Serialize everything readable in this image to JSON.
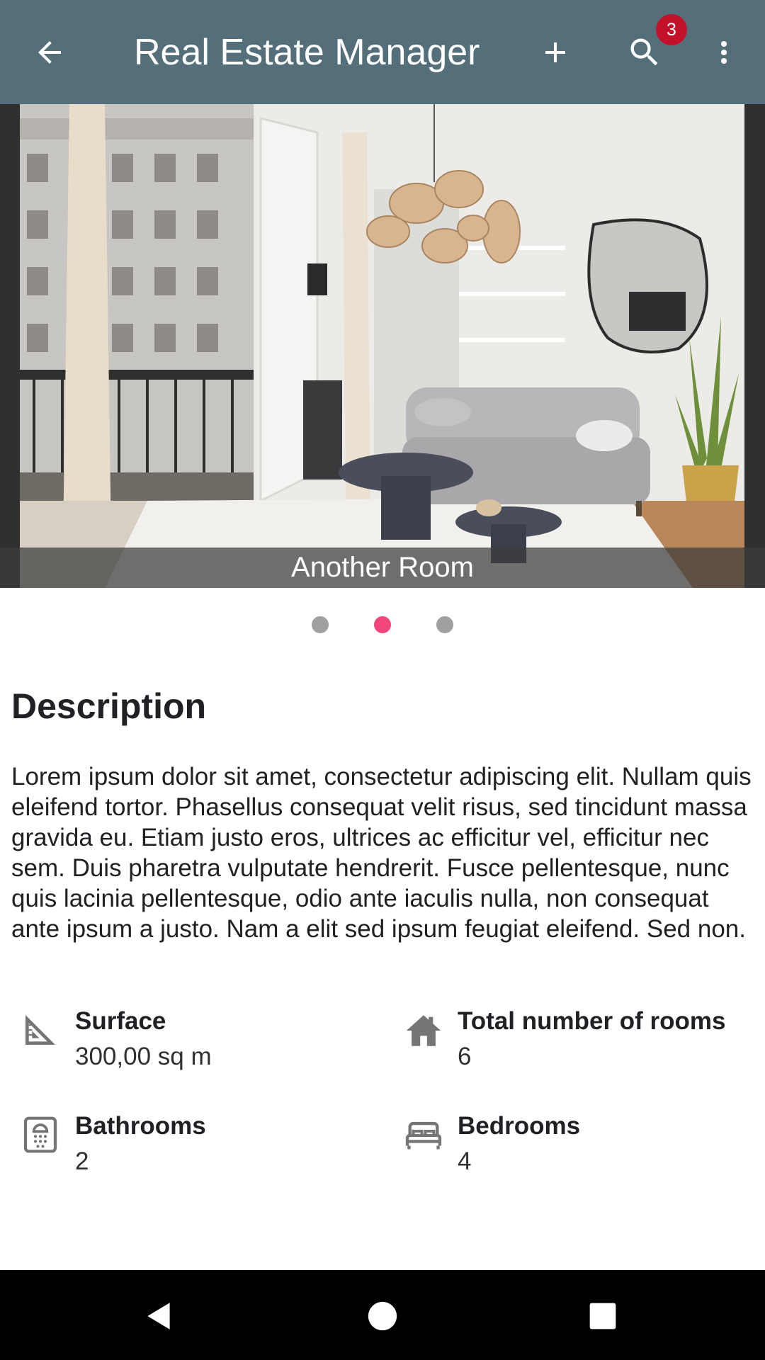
{
  "appbar": {
    "title": "Real Estate Manager",
    "back_icon": "arrow-back-icon",
    "add_icon": "add-icon",
    "search_icon": "search-icon",
    "search_badge": "3",
    "more_icon": "more-vert-icon",
    "background": "#546e7a"
  },
  "carousel": {
    "caption": "Another Room",
    "total_pages": 3,
    "active_page": 2,
    "dot_active_color": "#f0467a",
    "dot_inactive_color": "#a0a0a0"
  },
  "description": {
    "heading": "Description",
    "text": "Lorem ipsum dolor sit amet, consectetur adipiscing elit. Nullam quis eleifend tortor. Phasellus consequat velit risus, sed tincidunt massa gravida eu. Etiam justo eros, ultrices ac efficitur vel, efficitur nec sem. Duis pharetra vulputate hendrerit. Fusce pellentesque, nunc quis lacinia pellentesque, odio ante iaculis nulla, non consequat ante ipsum a justo. Nam a elit sed ipsum feugiat eleifend. Sed non."
  },
  "features": {
    "surface": {
      "label": "Surface",
      "value": "300,00 sq m",
      "icon": "set-square-icon"
    },
    "rooms": {
      "label": "Total number of rooms",
      "value": "6",
      "icon": "house-icon"
    },
    "bathrooms": {
      "label": "Bathrooms",
      "value": "2",
      "icon": "shower-icon"
    },
    "bedrooms": {
      "label": "Bedrooms",
      "value": "4",
      "icon": "bed-icon"
    }
  },
  "navbar": {
    "back_icon": "nav-back-icon",
    "home_icon": "nav-home-icon",
    "recents_icon": "nav-recents-icon"
  }
}
